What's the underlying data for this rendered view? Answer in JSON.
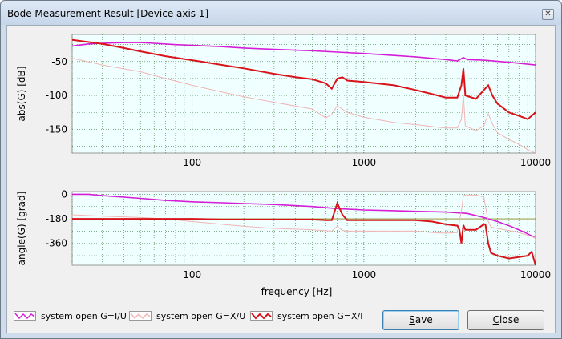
{
  "window": {
    "title": "Bode Measurement Result [Device axis 1]",
    "close_glyph": "✕"
  },
  "colors": {
    "plot_bg": "#f0ffff",
    "gi_u": "#d61dd6",
    "gx_u": "#f1b4b4",
    "gx_i": "#d8141a",
    "grid": "#3f7f3f"
  },
  "plots": {
    "magnitude": {
      "ylabel": "abs(G) [dB]",
      "yticks": [
        "-50",
        "-100",
        "-150"
      ],
      "xticks": [
        "100",
        "1000",
        "10000"
      ]
    },
    "phase": {
      "ylabel": "angle(G) [grad]",
      "yticks": [
        "0",
        "-180",
        "-360"
      ],
      "xticks": [
        "100",
        "1000",
        "10000"
      ],
      "xlabel": "frequency [Hz]"
    }
  },
  "chart_data": [
    {
      "type": "line",
      "ylabel": "abs(G) [dB]",
      "xscale": "log",
      "xlim": [
        20,
        10000
      ],
      "ylim": [
        -185,
        -10
      ],
      "grid": true,
      "series": [
        {
          "name": "system open G=I/U",
          "x": [
            20,
            25,
            30,
            40,
            50,
            60,
            80,
            100,
            150,
            200,
            300,
            500,
            700,
            1000,
            1500,
            2000,
            3000,
            3500,
            3800,
            4000,
            5000,
            7000,
            10000
          ],
          "y": [
            -27,
            -24,
            -23,
            -22,
            -22,
            -23,
            -25,
            -26,
            -28,
            -30,
            -32,
            -34,
            -36,
            -38,
            -41,
            -43,
            -47,
            -49,
            -44,
            -47,
            -48,
            -51,
            -55
          ]
        },
        {
          "name": "system open G=X/U",
          "x": [
            20,
            30,
            50,
            70,
            100,
            150,
            200,
            300,
            500,
            600,
            650,
            700,
            800,
            1000,
            1500,
            2000,
            2500,
            3000,
            3500,
            3700,
            3800,
            3900,
            4500,
            5000,
            5300,
            5600,
            6000,
            7000,
            8000,
            9000,
            10000
          ],
          "y": [
            -45,
            -55,
            -65,
            -75,
            -85,
            -95,
            -102,
            -110,
            -120,
            -133,
            -128,
            -115,
            -125,
            -132,
            -140,
            -143,
            -146,
            -148,
            -148,
            -135,
            -100,
            -145,
            -152,
            -145,
            -127,
            -142,
            -155,
            -165,
            -172,
            -180,
            -185
          ]
        },
        {
          "name": "system open G=X/I",
          "x": [
            20,
            30,
            40,
            50,
            70,
            100,
            150,
            200,
            300,
            400,
            500,
            600,
            650,
            700,
            750,
            800,
            1000,
            1500,
            2000,
            2500,
            3000,
            3500,
            3700,
            3800,
            3900,
            4500,
            5000,
            5300,
            5600,
            6000,
            7000,
            8000,
            9000,
            10000
          ],
          "y": [
            -18,
            -24,
            -30,
            -35,
            -42,
            -48,
            -55,
            -60,
            -68,
            -73,
            -76,
            -82,
            -90,
            -75,
            -73,
            -78,
            -80,
            -85,
            -92,
            -98,
            -103,
            -103,
            -85,
            -60,
            -100,
            -105,
            -92,
            -85,
            -100,
            -112,
            -125,
            -130,
            -135,
            -125
          ]
        }
      ]
    },
    {
      "type": "line",
      "ylabel": "angle(G) [grad]",
      "xlabel": "frequency [Hz]",
      "xscale": "log",
      "xlim": [
        20,
        10000
      ],
      "ylim": [
        -520,
        20
      ],
      "grid": true,
      "series": [
        {
          "name": "system open G=I/U",
          "x": [
            20,
            25,
            30,
            50,
            70,
            100,
            150,
            200,
            300,
            500,
            700,
            1000,
            1500,
            2000,
            3000,
            4000,
            5000,
            6000,
            7000,
            8000,
            9000,
            10000
          ],
          "y": [
            0,
            0,
            -10,
            -30,
            -45,
            -55,
            -62,
            -68,
            -75,
            -90,
            -105,
            -115,
            -120,
            -125,
            -130,
            -140,
            -170,
            -200,
            -230,
            -260,
            -290,
            -320
          ]
        },
        {
          "name": "system open G=X/U",
          "x": [
            20,
            30,
            50,
            70,
            100,
            200,
            300,
            500,
            650,
            700,
            750,
            800,
            1000,
            1500,
            2000,
            2500,
            3000,
            3500,
            3700,
            3800,
            3900,
            4500,
            5000,
            5300,
            5500,
            6000,
            7000,
            8000,
            9000,
            10000
          ],
          "y": [
            -150,
            -160,
            -170,
            -180,
            -200,
            -235,
            -250,
            -260,
            -270,
            -235,
            -265,
            -270,
            -270,
            -270,
            -270,
            -280,
            -285,
            -280,
            -120,
            -10,
            -5,
            -5,
            -20,
            -200,
            -240,
            -250,
            -265,
            -280,
            -300,
            -320
          ]
        },
        {
          "name": "system open G=X/I",
          "x": [
            20,
            50,
            100,
            150,
            200,
            300,
            500,
            600,
            650,
            700,
            750,
            800,
            1000,
            1500,
            2000,
            2500,
            3000,
            3500,
            3600,
            3700,
            3800,
            3900,
            4500,
            5000,
            5100,
            5300,
            5500,
            6000,
            7000,
            8000,
            9000,
            9500,
            10000
          ],
          "y": [
            -180,
            -180,
            -180,
            -185,
            -185,
            -185,
            -185,
            -190,
            -190,
            -65,
            -150,
            -190,
            -190,
            -190,
            -190,
            -200,
            -220,
            -230,
            -260,
            -360,
            -225,
            -260,
            -260,
            -220,
            -220,
            -360,
            -430,
            -450,
            -470,
            -460,
            -450,
            -420,
            -520
          ]
        }
      ]
    }
  ],
  "legend": [
    {
      "label": "system open G=I/U"
    },
    {
      "label": "system open G=X/U"
    },
    {
      "label": "system open G=X/I"
    }
  ],
  "buttons": {
    "save_first": "S",
    "save_rest": "ave",
    "close_first": "C",
    "close_rest": "lose"
  }
}
